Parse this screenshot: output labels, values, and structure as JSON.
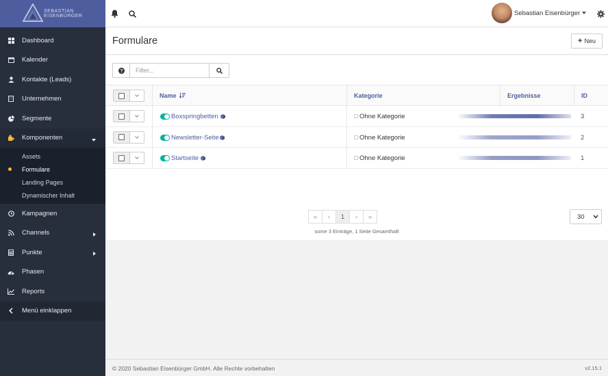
{
  "brand": {
    "logo_line1": "SEBASTIAN",
    "logo_line2": "EISENBÜRGER"
  },
  "sidebar": {
    "items": [
      {
        "label": "Dashboard",
        "icon": "dashboard-icon"
      },
      {
        "label": "Kalender",
        "icon": "calendar-icon"
      },
      {
        "label": "Kontakte (Leads)",
        "icon": "user-icon"
      },
      {
        "label": "Unternehmen",
        "icon": "building-icon"
      },
      {
        "label": "Segmente",
        "icon": "pie-chart-icon"
      },
      {
        "label": "Komponenten",
        "icon": "puzzle-icon"
      },
      {
        "label": "Kampagnen",
        "icon": "clock-icon"
      },
      {
        "label": "Channels",
        "icon": "rss-icon"
      },
      {
        "label": "Punkte",
        "icon": "calculator-icon"
      },
      {
        "label": "Phasen",
        "icon": "tachometer-icon"
      },
      {
        "label": "Reports",
        "icon": "line-chart-icon"
      },
      {
        "label": "Menü einklappen",
        "icon": "chevron-left-icon"
      }
    ],
    "sub_items": [
      {
        "label": "Assets"
      },
      {
        "label": "Formulare"
      },
      {
        "label": "Landing Pages"
      },
      {
        "label": "Dynamischer Inhalt"
      }
    ]
  },
  "topbar": {
    "user_name": "Sebastian Eisenbürger"
  },
  "page": {
    "title": "Formulare",
    "new_button": "Neu"
  },
  "filter": {
    "placeholder": "Filter..."
  },
  "table": {
    "columns": {
      "name": "Name",
      "category": "Kategorie",
      "results": "Ergebnisse",
      "id": "ID"
    },
    "rows": [
      {
        "name": "Boxspringbetten",
        "category": "Ohne Kategorie",
        "id": "3"
      },
      {
        "name": "Newsletter-Seite",
        "category": "Ohne Kategorie",
        "id": "2"
      },
      {
        "name": "Startseite",
        "category": "Ohne Kategorie",
        "id": "1"
      }
    ]
  },
  "pagination": {
    "first": "«",
    "prev": "‹",
    "page": "1",
    "next": "›",
    "last": "»",
    "info": "some 3 Einträge, 1 Seite Gesamthaft",
    "limit": "30"
  },
  "footer": {
    "copyright": "© 2020 Sebastian Eisenbürger GmbH. Alle Rechte vorbehalten",
    "version": "v2.15.1"
  },
  "colors": {
    "accent": "#4e5d9d",
    "toggle_on": "#00b49c",
    "sidebar_bg": "#272f3c",
    "active_dot": "#fdb933"
  }
}
